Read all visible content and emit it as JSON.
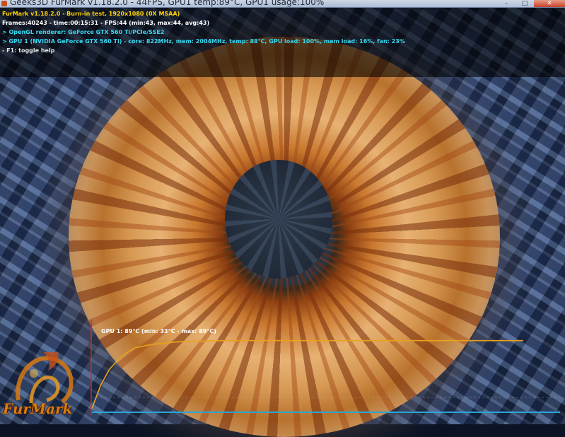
{
  "window": {
    "title": "Geeks3D FurMark v1.18.2.0 - 44FPS, GPU1 temp:89°C, GPU1 usage:100%",
    "minimize_icon": "minimize-icon",
    "maximize_icon": "maximize-icon",
    "close_icon": "close-icon"
  },
  "osd": {
    "line1": "FurMark v1.18.2.0 - Burn-in test, 1920x1080 (0X MSAA)",
    "line2": "Frames:40243 - time:00:15:31 - FPS:44 (min:43, max:44, avg:43)",
    "line3": "> OpenGL renderer: GeForce GTX 560 Ti/PCIe/SSE2",
    "line4": "> GPU 1 (NVIDIA GeForce GTX 560 Ti) - core: 822MHz, mem: 2004MHz, temp: 88°C, GPU load: 100%, mem load: 16%, fan: 23%",
    "line5": "- F1: toggle help"
  },
  "graph": {
    "label": "GPU 1: 89°C (min: 33°C - max: 89°C)",
    "colors": {
      "curve": "#e8a21c",
      "baseline": "#2aa6d8",
      "axis": "#d02a2a",
      "dash": "#b0b0b0"
    }
  },
  "chart_data": {
    "type": "line",
    "title": "GPU 1: 89°C (min: 33°C - max: 89°C)",
    "xlabel": "",
    "ylabel": "",
    "series": [
      {
        "name": "GPU 1",
        "x": [
          0,
          2,
          4,
          6,
          8,
          10,
          14,
          20,
          30,
          45,
          60,
          100
        ],
        "values": [
          33,
          52,
          65,
          73,
          79,
          83,
          86,
          88,
          89,
          89,
          89,
          89
        ]
      }
    ],
    "ylim": [
      30,
      95
    ],
    "grid": false
  },
  "logo": {
    "text": "FurMark"
  }
}
